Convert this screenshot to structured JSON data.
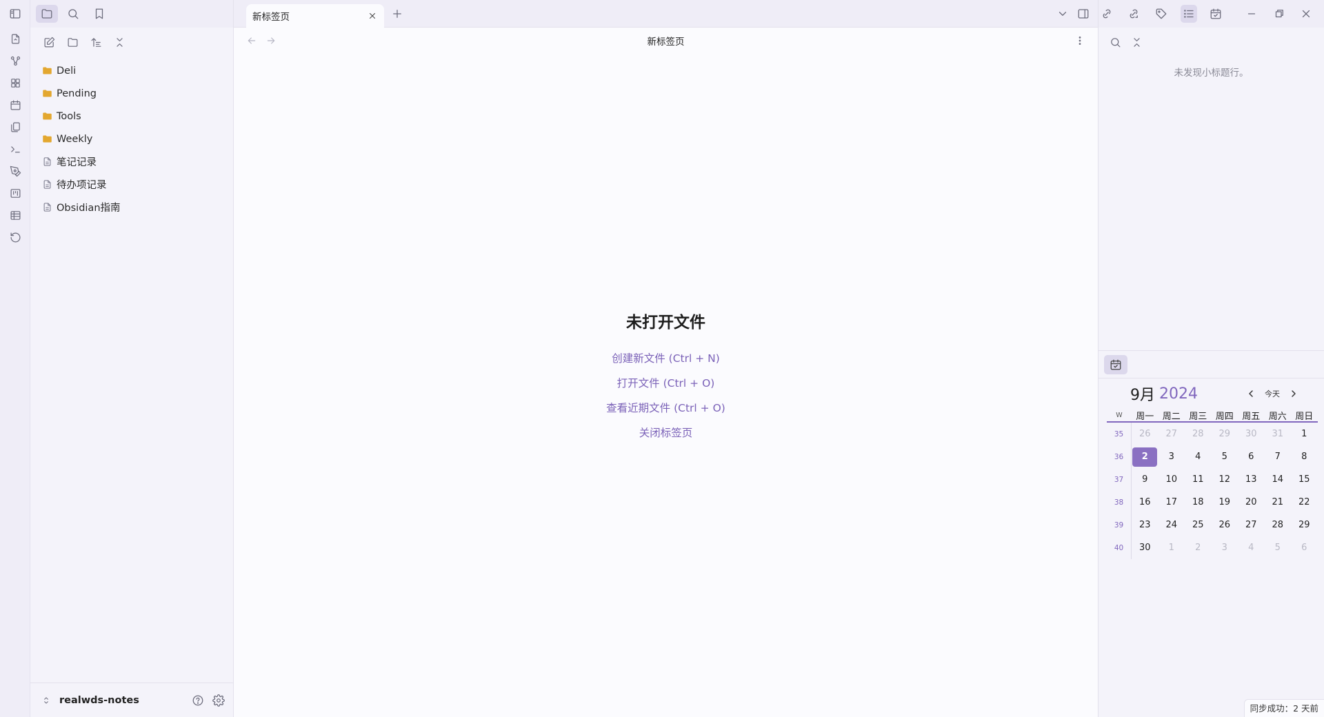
{
  "left_sidebar": {
    "tree": [
      {
        "label": "Deli",
        "type": "folder"
      },
      {
        "label": "Pending",
        "type": "folder"
      },
      {
        "label": "Tools",
        "type": "folder"
      },
      {
        "label": "Weekly",
        "type": "folder"
      },
      {
        "label": "笔记记录",
        "type": "file"
      },
      {
        "label": "待办项记录",
        "type": "file"
      },
      {
        "label": "Obsidian指南",
        "type": "file"
      }
    ],
    "vault_name": "realwds-notes"
  },
  "main": {
    "tab_title": "新标签页",
    "view_title": "新标签页",
    "empty_title": "未打开文件",
    "actions": [
      "创建新文件 (Ctrl + N)",
      "打开文件 (Ctrl + O)",
      "查看近期文件 (Ctrl + O)",
      "关闭标签页"
    ]
  },
  "right_sidebar": {
    "no_headings": "未发现小标题行。",
    "calendar": {
      "month": "9月",
      "year": "2024",
      "today_label": "今天",
      "weekday_headers": [
        "W",
        "周一",
        "周二",
        "周三",
        "周四",
        "周五",
        "周六",
        "周日"
      ],
      "weeks": [
        {
          "wk": "35",
          "days": [
            "26",
            "27",
            "28",
            "29",
            "30",
            "31",
            "1"
          ]
        },
        {
          "wk": "36",
          "days": [
            "2",
            "3",
            "4",
            "5",
            "6",
            "7",
            "8"
          ]
        },
        {
          "wk": "37",
          "days": [
            "9",
            "10",
            "11",
            "12",
            "13",
            "14",
            "15"
          ]
        },
        {
          "wk": "38",
          "days": [
            "16",
            "17",
            "18",
            "19",
            "20",
            "21",
            "22"
          ]
        },
        {
          "wk": "39",
          "days": [
            "23",
            "24",
            "25",
            "26",
            "27",
            "28",
            "29"
          ]
        },
        {
          "wk": "40",
          "days": [
            "30",
            "1",
            "2",
            "3",
            "4",
            "5",
            "6"
          ]
        }
      ]
    }
  },
  "status_bar": {
    "sync": "同步成功：2 天前"
  },
  "colors": {
    "accent": "#8066bd",
    "today_bg": "#8a70c2",
    "folder": "#e3a72f"
  }
}
